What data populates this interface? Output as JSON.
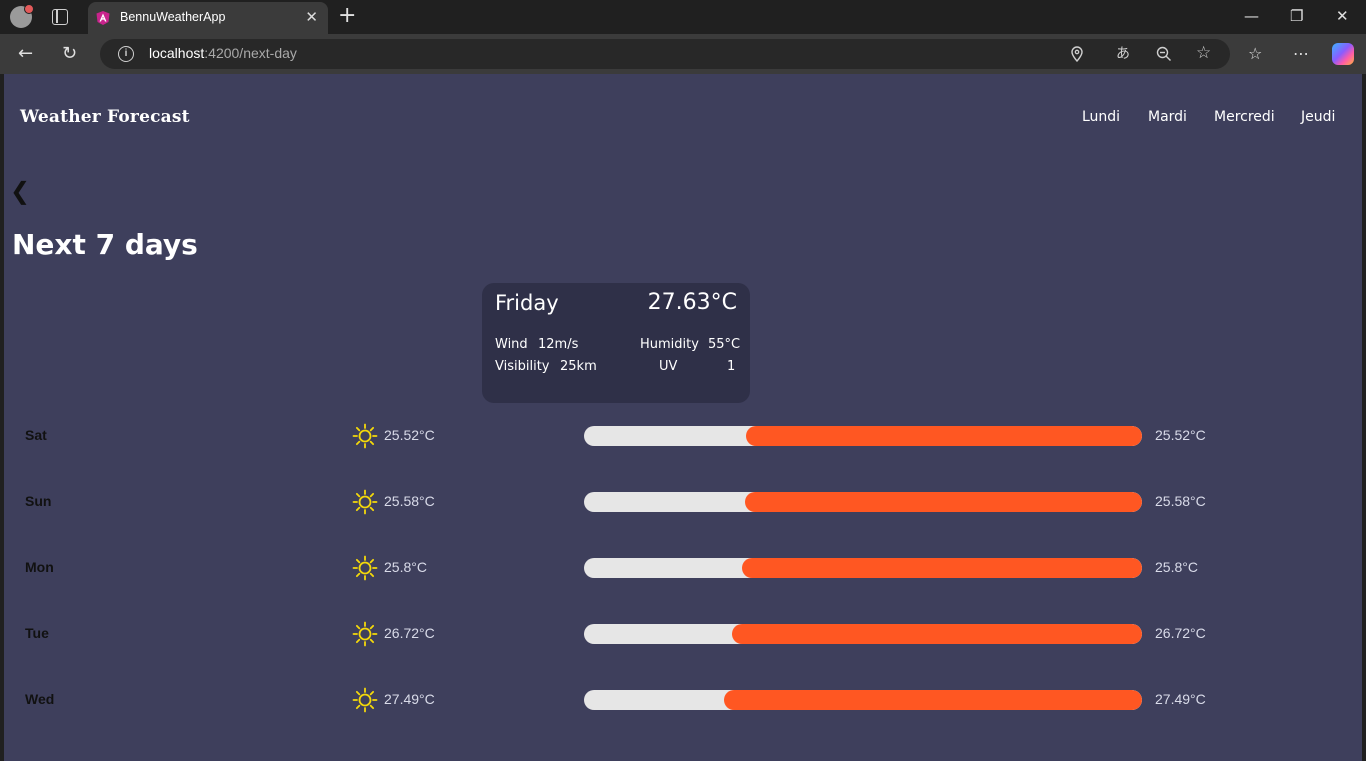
{
  "browser": {
    "tab_title": "BennuWeatherApp",
    "url_host": "localhost",
    "url_path": ":4200/next-day"
  },
  "app": {
    "brand": "Weather Forecast",
    "nav": [
      "Lundi",
      "Mardi",
      "Mercredi",
      "Jeudi"
    ],
    "back_symbol": "❮",
    "heading": "Next 7 days"
  },
  "today_card": {
    "day": "Friday",
    "temp": "27.63°C",
    "wind_label": "Wind",
    "wind_value": "12m/s",
    "visibility_label": "Visibility",
    "visibility_value": "25km",
    "humidity_label": "Humidity",
    "humidity_value": "55°C",
    "uv_label": "UV",
    "uv_value": "1"
  },
  "forecast": [
    {
      "day": "Sat",
      "icon": "sun-icon",
      "temp": "25.52°C",
      "fill_fraction": 0.71
    },
    {
      "day": "Sun",
      "icon": "sun-icon",
      "temp": "25.58°C",
      "fill_fraction": 0.712
    },
    {
      "day": "Mon",
      "icon": "sun-icon",
      "temp": "25.8°C",
      "fill_fraction": 0.717
    },
    {
      "day": "Tue",
      "icon": "sun-icon",
      "temp": "26.72°C",
      "fill_fraction": 0.735
    },
    {
      "day": "Wed",
      "icon": "sun-icon",
      "temp": "27.49°C",
      "fill_fraction": 0.75
    }
  ],
  "colors": {
    "page_bg": "#3e3f5c",
    "card_bg": "#2f3048",
    "bar_track": "#e6e6e6",
    "bar_fill": "#ff5722",
    "sun": "#f5d90a"
  }
}
